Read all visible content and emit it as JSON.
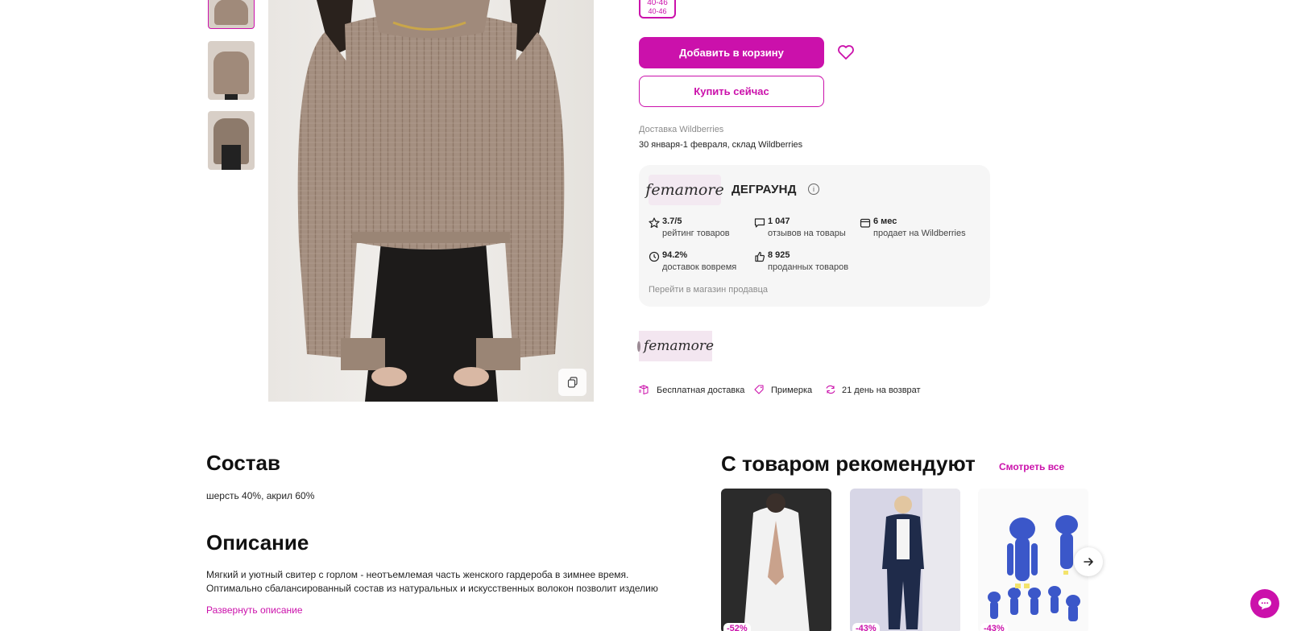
{
  "product": {
    "size_chip": {
      "primary": "40-46",
      "secondary": "40-46"
    },
    "add_to_cart": "Добавить в корзину",
    "buy_now": "Купить сейчас",
    "delivery_label": "Доставка Wildberries",
    "delivery_date": "30 января-1 февраля, склад Wildberries"
  },
  "seller": {
    "logo_text": "femamore",
    "name": "ДЕГРАУНД",
    "stats": [
      {
        "icon": "star-icon",
        "value": "3.7/5",
        "label": "рейтинг товаров"
      },
      {
        "icon": "chat-bubble-icon",
        "value": "1 047",
        "label": "отзывов на товары"
      },
      {
        "icon": "calendar-icon",
        "value": "6 мес",
        "label": "продает на Wildberries"
      },
      {
        "icon": "clock-icon",
        "value": "94.2%",
        "label": "доставок вовремя"
      },
      {
        "icon": "thumbs-up-icon",
        "value": "8 925",
        "label": "проданных товаров"
      }
    ],
    "store_link": "Перейти в магазин продавца"
  },
  "brand": {
    "logo_text": "femamore"
  },
  "perks": [
    {
      "icon": "delivery-box-icon",
      "label": "Бесплатная доставка"
    },
    {
      "icon": "tag-icon",
      "label": "Примерка"
    },
    {
      "icon": "return-icon",
      "label": "21 день на возврат"
    }
  ],
  "composition": {
    "title": "Состав",
    "text": "шерсть 40%, акрил 60%"
  },
  "description": {
    "title": "Описание",
    "line1": "Мягкий и уютный свитер с горлом - неотъемлемая часть женского гардероба в зимнее время.",
    "line2": "Оптимально сбалансированный состав из натуральных и искусственных волокон позволит изделию",
    "expand": "Развернуть описание"
  },
  "recommend": {
    "title": "С товаром рекомендуют",
    "see_all": "Смотреть все",
    "cards": [
      {
        "discount": "-52%"
      },
      {
        "discount": "-43%"
      },
      {
        "discount": "-43%"
      }
    ]
  },
  "colors": {
    "accent": "#cb11ab",
    "sweater": "#a48f80",
    "card_bg": "#f6f6f6"
  }
}
